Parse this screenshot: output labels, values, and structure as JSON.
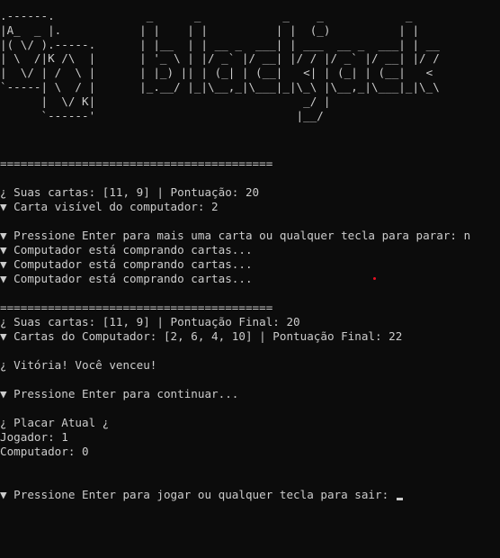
{
  "art": {
    "card": ".------.\n|A_  _ |.\n|( \\/ ).-----.\n| \\  /|K /\\  |\n|  \\/ | /  \\ |\n`-----| \\  / |\n      |  \\/ K|\n      `------'",
    "logo": "   _      _            _    _            _\n  | |    | |          | |  (_)          | |\n  | |__  | | __ _  ___| | ___  __ _  ___| | __\n  | '_ \\ | |/ _` |/ __| |/ / |/ _` |/ __| |/ /\n  | |_) || | (_| | (__|   <| | (_| | (__|   <\n  |_.__/ |_|\\__,_|\\___|_|\\_\\ |\\__,_|\\___|_|\\_\\\n                          _/ |\n                         |__/"
  },
  "lines": [
    "========================================",
    "¿ Suas cartas: [11, 9] | Pontuação: 20",
    "▼ Carta visível do computador: 2",
    "▼ Pressione Enter para mais uma carta ou qualquer tecla para parar: n",
    "▼ Computador está comprando cartas...",
    "▼ Computador está comprando cartas...",
    "▼ Computador está comprando cartas...",
    "========================================",
    "¿ Suas cartas: [11, 9] | Pontuação Final: 20",
    "▼ Cartas do Computador: [2, 6, 4, 10] | Pontuação Final: 22",
    "¿ Vitória! Você venceu!",
    "▼ Pressione Enter para continuar...",
    "¿ Placar Atual ¿",
    "Jogador: 1",
    "Computador: 0",
    "▼ Pressione Enter para jogar ou qualquer tecla para sair: "
  ],
  "colors": {
    "background": "#0c0c0c",
    "text": "#cccccc",
    "dot": "#e81123"
  }
}
